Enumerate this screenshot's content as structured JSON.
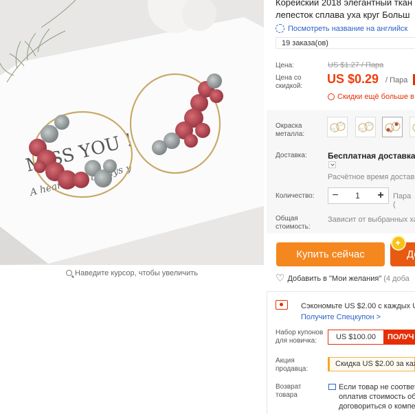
{
  "title": {
    "line1": "Корейский 2018 элегантный ткан",
    "line2": "лепесток сплава уха круг Больш"
  },
  "translate_link": "Посмотреть название на английск",
  "orders": "19 заказа(ов)",
  "price": {
    "label": "Цена:",
    "old": "US $1.27 / Пара",
    "discount_label": "Цена со скидкой:",
    "new": "US $0.29",
    "per": "/ Пара",
    "coupon_alert": "Скидки ещё больше в"
  },
  "specs": {
    "color_label": "Окраска металла:",
    "delivery_label": "Доставка:",
    "delivery_value": "Бесплатная доставка в",
    "delivery_time": "Расчётное время доставк",
    "quantity_label": "Количество:",
    "quantity_value": "1",
    "quantity_minus": "−",
    "quantity_plus": "+",
    "quantity_unit": "Пара (",
    "total_label": "Общая стоимость:",
    "total_value": "Зависит от выбранных хар"
  },
  "buttons": {
    "buy_now": "Купить сейчас",
    "add_to_cart": "До"
  },
  "wishlist": {
    "label": "Добавить в \"Мои желания\"",
    "count": "(4 доба"
  },
  "promo": {
    "save_text": "Сэкономьте US $2.00 с каждых US",
    "save_link": "Получите Спецкупон >",
    "newuser_label": "Набор купонов для новичка:",
    "newuser_amount": "US $100.00",
    "newuser_get": "ПОЛУЧ",
    "seller_label": "Акция продавца:",
    "seller_text": "Скидка US $2.00 за кажд",
    "return_label": "Возврат товара",
    "return_text": "Если товар не соответ\nоплатив стоимость об\nдоговориться о компе"
  },
  "zoom_hint": "Наведите курсор, чтобы увеличить",
  "image": {
    "card_text_1": "MISS  YOU !",
    "card_text_2": "A heart ... is always y"
  },
  "colors": {
    "accent": "#f13b0a",
    "buy": "#f5871f",
    "cart": "#e85a12",
    "link": "#2a60c9"
  }
}
